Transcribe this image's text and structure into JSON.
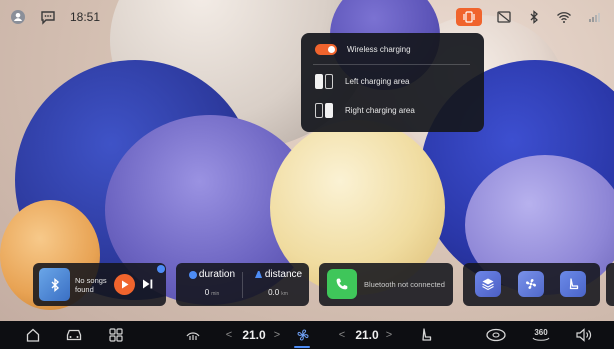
{
  "status_bar": {
    "time": "18:51",
    "icons": [
      "account-icon",
      "message-icon",
      "wireless-charging-status-icon",
      "screen-icon",
      "bluetooth-icon",
      "wifi-icon",
      "cellular-signal-icon"
    ],
    "accent_color": "#f0642d"
  },
  "charging_popup": {
    "toggle_label": "Wireless charging",
    "toggle_on": true,
    "left_area_label": "Left charging area",
    "right_area_label": "Right charging area"
  },
  "music": {
    "status": "No songs found",
    "play_icon": "play-icon",
    "next_icon": "next-track-icon"
  },
  "trip": {
    "duration_label": "duration",
    "duration_value": "0",
    "duration_unit": "min",
    "distance_label": "distance",
    "distance_value": "0.0",
    "distance_unit": "km"
  },
  "phone": {
    "status": "Bluetooth not connected"
  },
  "quick_actions": [
    "layers-icon",
    "fan-icon",
    "seat-icon"
  ],
  "dock": {
    "left_temp": "21.0",
    "right_temp": "21.0",
    "view_360_label": "360",
    "icons": [
      "home-icon",
      "car-icon",
      "apps-grid-icon",
      "seat-heat-icon",
      "fan-icon",
      "seat-recline-icon",
      "steering-wheel-icon",
      "volume-icon"
    ]
  }
}
